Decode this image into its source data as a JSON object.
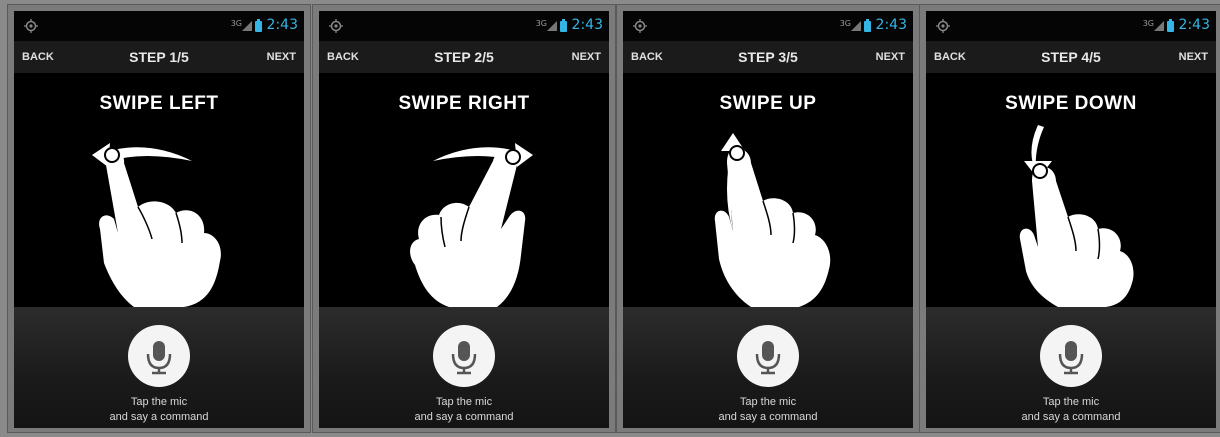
{
  "panels": [
    {
      "status": {
        "network": "3G",
        "time": "2:43"
      },
      "nav": {
        "back": "BACK",
        "step": "STEP 1/5",
        "next": "NEXT"
      },
      "gesture": "SWIPE LEFT",
      "gesture_icon": "swipe-left-hand-icon",
      "hint_line1": "Tap the mic",
      "hint_line2": "and say a command"
    },
    {
      "status": {
        "network": "3G",
        "time": "2:43"
      },
      "nav": {
        "back": "BACK",
        "step": "STEP 2/5",
        "next": "NEXT"
      },
      "gesture": "SWIPE RIGHT",
      "gesture_icon": "swipe-right-hand-icon",
      "hint_line1": "Tap the mic",
      "hint_line2": "and say a command"
    },
    {
      "status": {
        "network": "3G",
        "time": "2:43"
      },
      "nav": {
        "back": "BACK",
        "step": "STEP 3/5",
        "next": "NEXT"
      },
      "gesture": "SWIPE UP",
      "gesture_icon": "swipe-up-hand-icon",
      "hint_line1": "Tap the mic",
      "hint_line2": "and say a command"
    },
    {
      "status": {
        "network": "3G",
        "time": "2:43"
      },
      "nav": {
        "back": "BACK",
        "step": "STEP 4/5",
        "next": "NEXT"
      },
      "gesture": "SWIPE DOWN",
      "gesture_icon": "swipe-down-hand-icon",
      "hint_line1": "Tap the mic",
      "hint_line2": "and say a command"
    }
  ],
  "colors": {
    "accent": "#35b5e5",
    "background": "#000000",
    "frame": "#7b7b7b"
  }
}
